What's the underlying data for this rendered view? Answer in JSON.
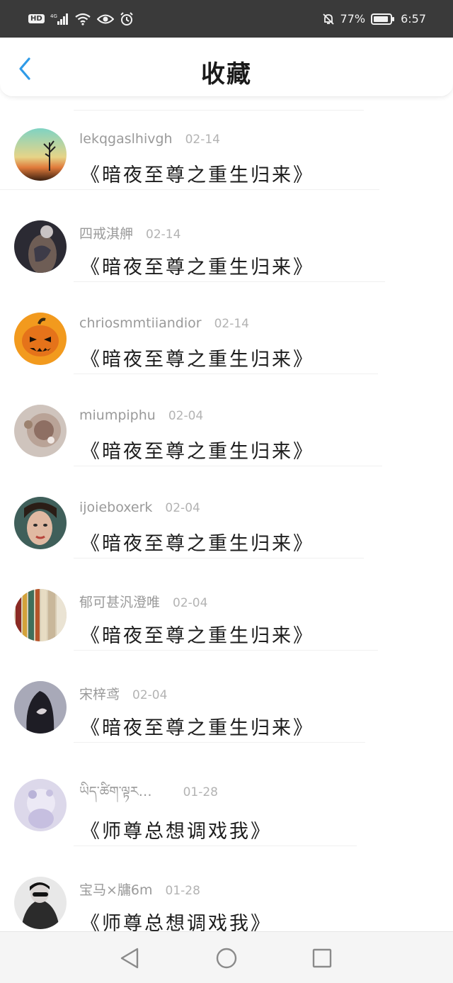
{
  "status_bar": {
    "hd_label": "HD",
    "network": "4G",
    "battery_percent": "77%",
    "time": "6:57",
    "icons": [
      "hd-icon",
      "signal-icon",
      "wifi-icon",
      "eye-icon",
      "alarm-icon",
      "mute-icon",
      "battery-icon"
    ]
  },
  "header": {
    "title": "收藏",
    "back_icon": "chevron-left-icon",
    "accent_color": "#2f9be8"
  },
  "items": [
    {
      "username": "lekqgaslhivgh",
      "date": "02-14",
      "title": "《暗夜至尊之重生归来》"
    },
    {
      "username": "四戒淇舺",
      "date": "02-14",
      "title": "《暗夜至尊之重生归来》"
    },
    {
      "username": "chriosmmtiiandior",
      "date": "02-14",
      "title": "《暗夜至尊之重生归来》"
    },
    {
      "username": "miumpiphu",
      "date": "02-04",
      "title": "《暗夜至尊之重生归来》"
    },
    {
      "username": "ijoieboxerk",
      "date": "02-04",
      "title": "《暗夜至尊之重生归来》"
    },
    {
      "username": "郁可甚汎澄唯",
      "date": "02-04",
      "title": "《暗夜至尊之重生归来》"
    },
    {
      "username": "宋梓鸢",
      "date": "02-04",
      "title": "《暗夜至尊之重生归来》"
    },
    {
      "username": "ཡིད་ཚིག་ལྟར…",
      "date": "01-28",
      "title": "《师尊总想调戏我》"
    },
    {
      "username": "宝马×牗6m",
      "date": "01-28",
      "title": "《师尊总想调戏我》"
    }
  ],
  "nav_bar": {
    "icons": [
      "back-triangle-icon",
      "home-circle-icon",
      "recents-square-icon"
    ]
  }
}
